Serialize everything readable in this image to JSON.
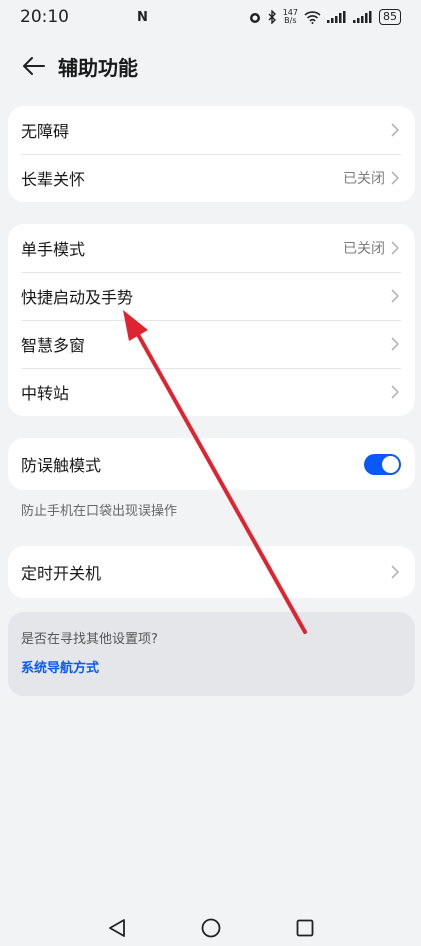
{
  "status_bar": {
    "time": "20:10",
    "nfc": "N",
    "net_speed_value": "147",
    "net_speed_unit": "B/s",
    "battery": "85"
  },
  "header": {
    "title": "辅助功能"
  },
  "groups": {
    "g1": [
      {
        "label": "无障碍",
        "value": ""
      },
      {
        "label": "长辈关怀",
        "value": "已关闭"
      }
    ],
    "g2": [
      {
        "label": "单手模式",
        "value": "已关闭"
      },
      {
        "label": "快捷启动及手势",
        "value": ""
      },
      {
        "label": "智慧多窗",
        "value": ""
      },
      {
        "label": "中转站",
        "value": ""
      }
    ],
    "g3": [
      {
        "label": "防误触模式",
        "toggle": "on"
      }
    ],
    "g3_hint": "防止手机在口袋出现误操作",
    "g4": [
      {
        "label": "定时开关机",
        "value": ""
      }
    ]
  },
  "search_suggestion": {
    "question": "是否在寻找其他设置项?",
    "link": "系统导航方式"
  },
  "colors": {
    "accent": "#0a59f7",
    "annotation_arrow": "#e02330"
  }
}
